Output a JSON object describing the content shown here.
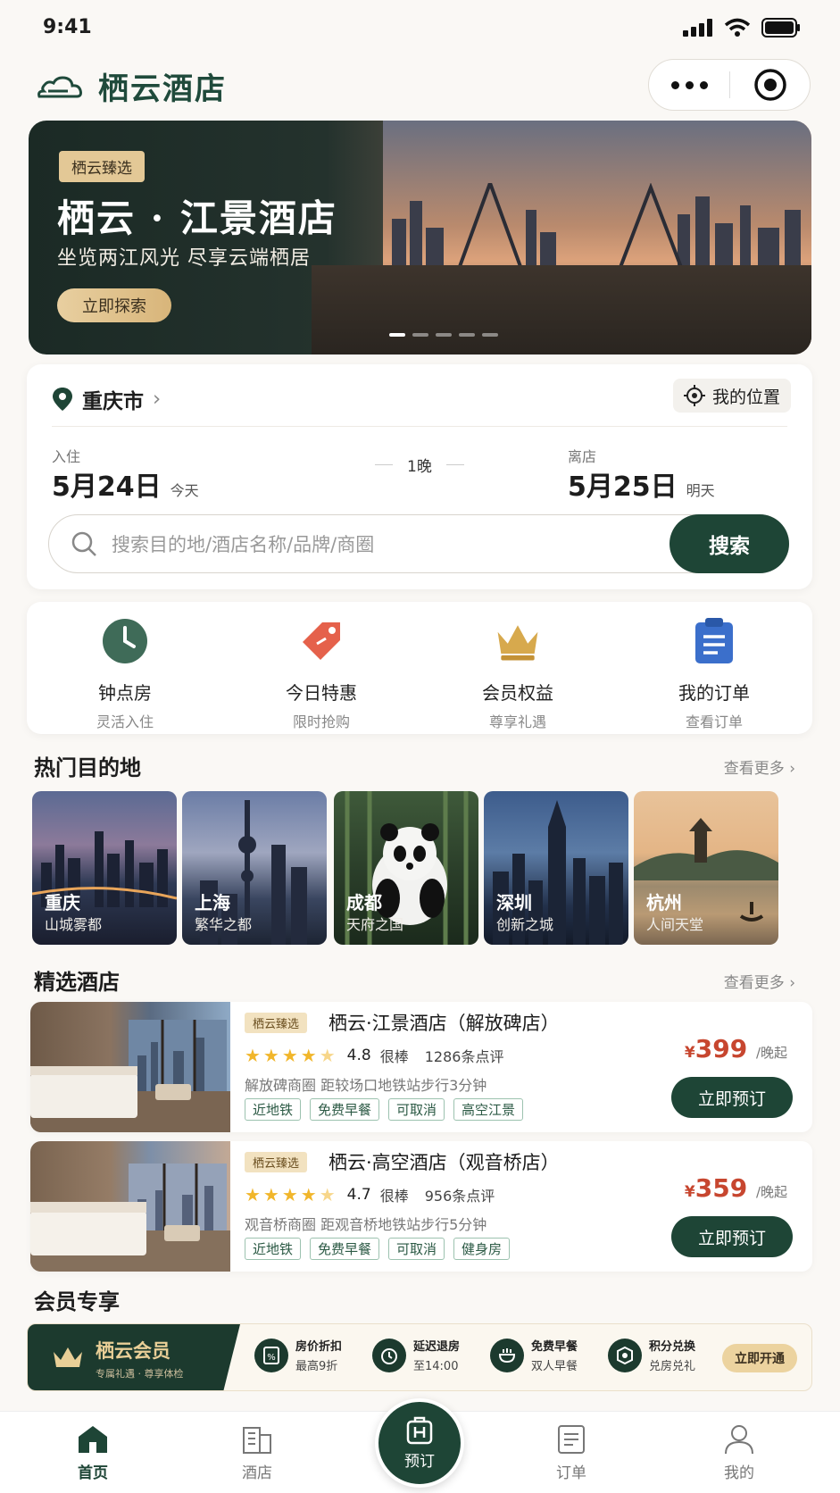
{
  "status": {
    "time": "9:41"
  },
  "header": {
    "app_name": "栖云酒店"
  },
  "banner": {
    "tag": "栖云臻选",
    "title": "栖云 · 江景酒店",
    "subtitle": "坐览两江风光  尽享云端栖居",
    "cta": "立即探索"
  },
  "search": {
    "city": "重庆市",
    "my_location": "我的位置",
    "checkin_label": "入住",
    "checkin_date": "5月24日",
    "checkin_note": "今天",
    "nights": "1晚",
    "checkout_label": "离店",
    "checkout_date": "5月25日",
    "checkout_note": "明天",
    "placeholder": "搜索目的地/酒店名称/品牌/商圈",
    "button": "搜索"
  },
  "quick_actions": [
    {
      "title": "钟点房",
      "sub": "灵活入住",
      "icon": "clock-icon"
    },
    {
      "title": "今日特惠",
      "sub": "限时抢购",
      "icon": "tag-icon"
    },
    {
      "title": "会员权益",
      "sub": "尊享礼遇",
      "icon": "crown-icon"
    },
    {
      "title": "我的订单",
      "sub": "查看订单",
      "icon": "clipboard-icon"
    }
  ],
  "destinations": {
    "title": "热门目的地",
    "more": "查看更多",
    "items": [
      {
        "name": "重庆",
        "sub": "山城雾都"
      },
      {
        "name": "上海",
        "sub": "繁华之都"
      },
      {
        "name": "成都",
        "sub": "天府之国"
      },
      {
        "name": "深圳",
        "sub": "创新之城"
      },
      {
        "name": "杭州",
        "sub": "人间天堂"
      }
    ]
  },
  "hotels": {
    "title": "精选酒店",
    "more": "查看更多",
    "items": [
      {
        "tag": "栖云臻选",
        "name": "栖云·江景酒店（解放碑店）",
        "score": "4.8",
        "level": "很棒",
        "reviews": "1286条点评",
        "location": "解放碑商圈  距较场口地铁站步行3分钟",
        "tags": [
          "近地铁",
          "免费早餐",
          "可取消",
          "高空江景"
        ],
        "currency": "¥",
        "price": "399",
        "unit": "/晚起",
        "book": "立即预订",
        "rating_value": 4.5
      },
      {
        "tag": "栖云臻选",
        "name": "栖云·高空酒店（观音桥店）",
        "score": "4.7",
        "level": "很棒",
        "reviews": "956条点评",
        "location": "观音桥商圈  距观音桥地铁站步行5分钟",
        "tags": [
          "近地铁",
          "免费早餐",
          "可取消",
          "健身房"
        ],
        "currency": "¥",
        "price": "359",
        "unit": "/晚起",
        "book": "立即预订",
        "rating_value": 4.5
      }
    ]
  },
  "member": {
    "title": "会员专享",
    "name": "栖云会员",
    "sub": "专属礼遇 · 尊享体检",
    "perks": [
      {
        "t": "房价折扣",
        "s": "最高9折"
      },
      {
        "t": "延迟退房",
        "s": "至14:00"
      },
      {
        "t": "免费早餐",
        "s": "双人早餐"
      },
      {
        "t": "积分兑换",
        "s": "兑房兑礼"
      }
    ],
    "open": "立即开通"
  },
  "tabbar": {
    "home": "首页",
    "hotel": "酒店",
    "book": "预订",
    "orders": "订单",
    "mine": "我的"
  },
  "colors": {
    "primary": "#1e4536",
    "accent_gold": "#e3c896",
    "price": "#c7462f"
  }
}
